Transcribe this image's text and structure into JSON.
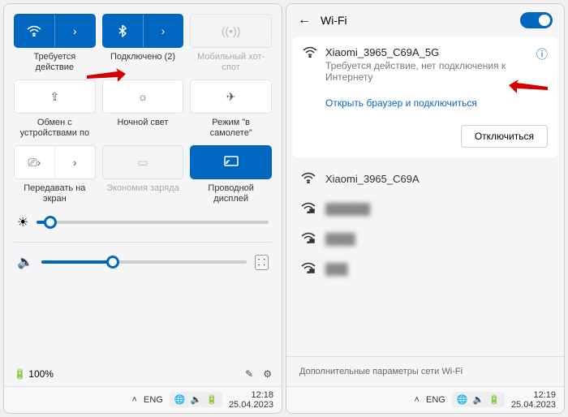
{
  "left": {
    "tiles": {
      "wifi": {
        "label": "Требуется действие"
      },
      "bt": {
        "label": "Подключено (2)"
      },
      "hotspot": {
        "label": "Мобильный хот-спот"
      },
      "share": {
        "label": "Обмен с устройствами по"
      },
      "night": {
        "label": "Ночной свет"
      },
      "airplane": {
        "label": "Режим \"в самолете\""
      },
      "cast": {
        "label": "Передавать на экран"
      },
      "battery_saver": {
        "label": "Экономия заряда"
      },
      "wired": {
        "label": "Проводной дисплей"
      }
    },
    "battery": "100%",
    "taskbar": {
      "lang": "ENG",
      "time": "12:18",
      "date": "25.04.2023"
    }
  },
  "right": {
    "title": "Wi-Fi",
    "current": {
      "name": "Xiaomi_3965_C69A_5G",
      "status": "Требуется действие, нет подключения к Интернету",
      "link": "Открыть браузер и подключиться",
      "disconnect": "Отключиться"
    },
    "networks": [
      "Xiaomi_3965_C69A",
      "",
      "",
      ""
    ],
    "footer": "Дополнительные параметры сети Wi-Fi",
    "taskbar": {
      "lang": "ENG",
      "time": "12:19",
      "date": "25.04.2023"
    }
  }
}
